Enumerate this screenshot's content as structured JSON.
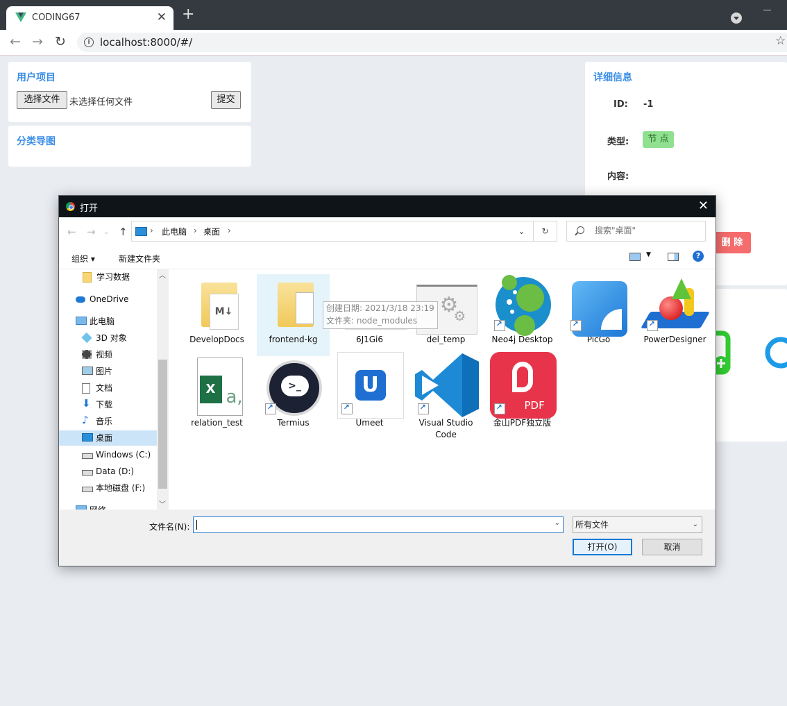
{
  "browser": {
    "tab_title": "CODING67",
    "url": "localhost:8000/#/",
    "new_tab": "+",
    "close_tab": "✕"
  },
  "left_panel": {
    "project_title": "用户项目",
    "choose_file": "选择文件",
    "no_file": "未选择任何文件",
    "submit": "提交",
    "category_title": "分类导图"
  },
  "detail_panel": {
    "title": "详细信息",
    "id_label": "ID:",
    "id_value": "-1",
    "type_label": "类型:",
    "type_value": "节 点",
    "content_label": "内容:",
    "delete": "删 除"
  },
  "dialog": {
    "title": "打开",
    "breadcrumb": [
      "此电脑",
      "桌面"
    ],
    "search_placeholder": "搜索\"桌面\"",
    "organize": "组织 ▾",
    "new_folder": "新建文件夹",
    "nav_items": [
      {
        "label": "学习数据",
        "icon": "folder-icon"
      },
      {
        "label": "OneDrive",
        "icon": "cloud-icon"
      },
      {
        "label": "此电脑",
        "icon": "pc-icon"
      },
      {
        "label": "3D 对象",
        "icon": "cube-icon"
      },
      {
        "label": "视频",
        "icon": "video-icon"
      },
      {
        "label": "图片",
        "icon": "picture-icon"
      },
      {
        "label": "文档",
        "icon": "document-icon"
      },
      {
        "label": "下载",
        "icon": "download-icon"
      },
      {
        "label": "音乐",
        "icon": "music-icon"
      },
      {
        "label": "桌面",
        "icon": "desktop-icon"
      },
      {
        "label": "Windows (C:)",
        "icon": "drive-icon"
      },
      {
        "label": "Data (D:)",
        "icon": "drive-icon"
      },
      {
        "label": "本地磁盘 (F:)",
        "icon": "drive-icon"
      },
      {
        "label": "网络",
        "icon": "network-icon"
      }
    ],
    "files": [
      {
        "label": "DevelopDocs",
        "icon": "markdown-folder-icon"
      },
      {
        "label": "frontend-kg",
        "icon": "folder-icon"
      },
      {
        "label": "6J1Gi6",
        "icon": "file-icon"
      },
      {
        "label": "del_temp",
        "icon": "settings-file-icon"
      },
      {
        "label": "Neo4j Desktop",
        "icon": "neo4j-icon"
      },
      {
        "label": "PicGo",
        "icon": "picgo-icon"
      },
      {
        "label": "PowerDesigner",
        "icon": "powerdesigner-icon"
      },
      {
        "label": "relation_test",
        "icon": "excel-csv-icon"
      },
      {
        "label": "Termius",
        "icon": "termius-icon"
      },
      {
        "label": "Umeet",
        "icon": "umeet-icon"
      },
      {
        "label": "Visual Studio Code",
        "icon": "vscode-icon"
      },
      {
        "label": "金山PDF独立版",
        "icon": "kingsoft-pdf-icon"
      }
    ],
    "tooltip_line1": "创建日期: 2021/3/18 23:19",
    "tooltip_line2": "文件夹: node_modules",
    "filename_label": "文件名(N):",
    "filename_value": "",
    "filetype": "所有文件",
    "open": "打开(O)",
    "cancel": "取消"
  }
}
